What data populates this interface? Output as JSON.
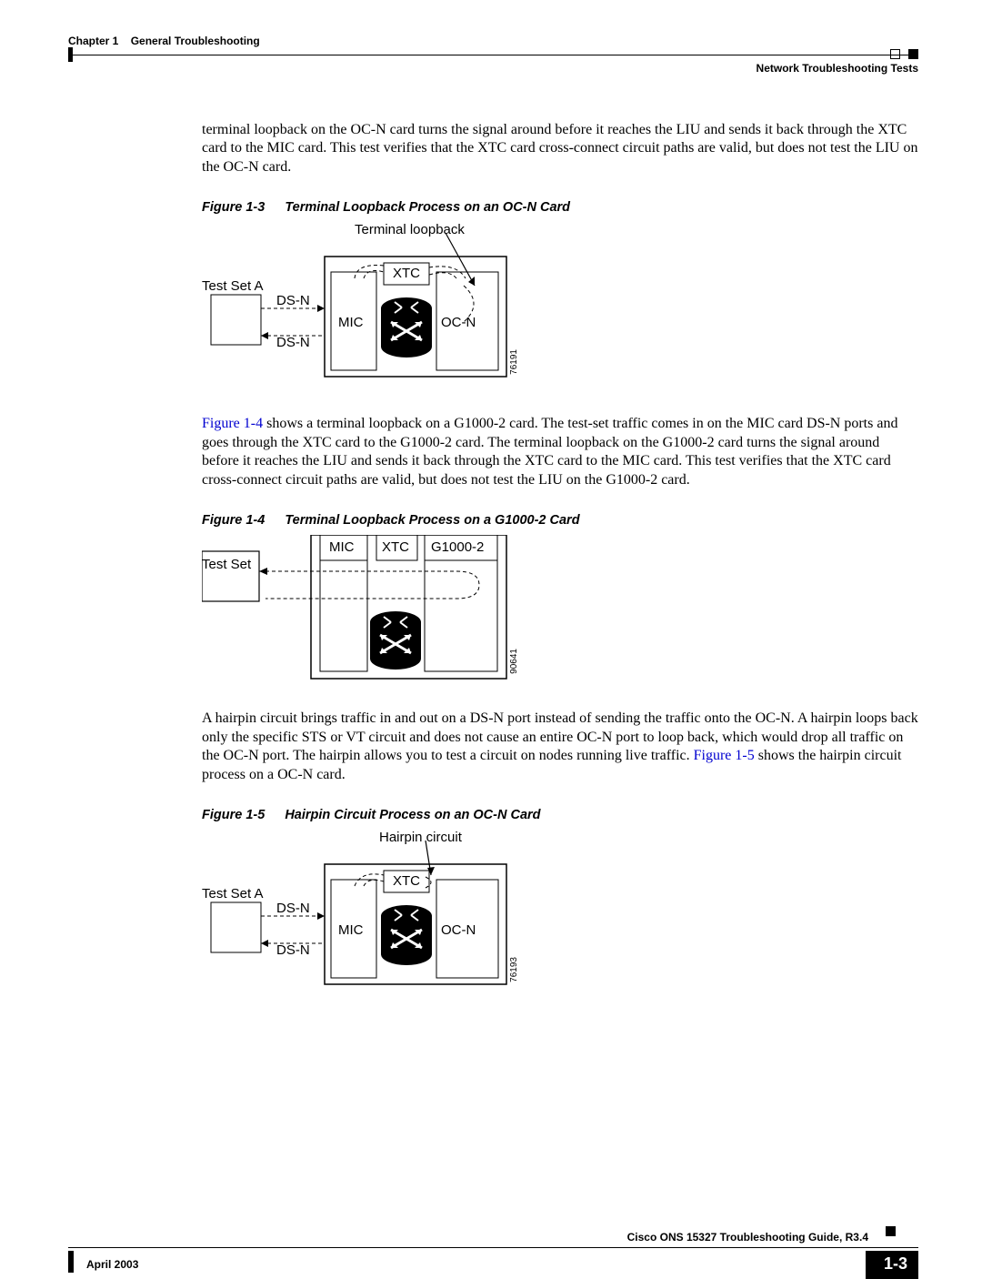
{
  "header": {
    "chapter_num": "Chapter 1",
    "chapter_name": "General Troubleshooting",
    "section": "Network Troubleshooting Tests"
  },
  "paragraphs": {
    "p1": "terminal loopback on the OC-N card turns the signal around before it reaches the LIU and sends it back through the XTC card to the MIC card. This test verifies that the XTC card cross-connect circuit paths are valid, but does not test the LIU on the OC-N card.",
    "p2_link": "Figure 1-4",
    "p2_rest": " shows a terminal loopback on a G1000-2 card. The test-set traffic comes in on the MIC card DS-N ports and goes through the XTC card to the G1000-2 card. The terminal loopback on the G1000-2 card turns the signal around before it reaches the LIU and sends it back through the XTC card to the MIC card. This test verifies that the XTC card cross-connect circuit paths are valid, but does not test the LIU on the G1000-2 card.",
    "p3_a": "A hairpin circuit brings traffic in and out on a DS-N port instead of sending the traffic onto the OC-N. A hairpin loops back only the specific STS or VT circuit and does not cause an entire OC-N port to loop back, which would drop all traffic on the OC-N port. The hairpin allows you to test a circuit on nodes running live traffic. ",
    "p3_link": "Figure 1-5",
    "p3_b": " shows the hairpin circuit process on a OC-N card."
  },
  "figures": {
    "f13": {
      "num": "Figure 1-3",
      "title": "Terminal Loopback Process on an OC-N Card"
    },
    "f14": {
      "num": "Figure 1-4",
      "title": "Terminal Loopback Process on a G1000-2 Card"
    },
    "f15": {
      "num": "Figure 1-5",
      "title": "Hairpin Circuit Process on an OC-N Card"
    }
  },
  "diagram1": {
    "top_label": "Terminal loopback",
    "test_set": "Test Set A",
    "dsn_top": "DS-N",
    "dsn_bot": "DS-N",
    "mic": "MIC",
    "xtc": "XTC",
    "ocn": "OC-N",
    "id": "76191"
  },
  "diagram2": {
    "test_set": "Test Set",
    "mic": "MIC",
    "xtc": "XTC",
    "g1000": "G1000-2",
    "id": "90641"
  },
  "diagram3": {
    "top_label": "Hairpin circuit",
    "test_set": "Test Set A",
    "dsn_top": "DS-N",
    "dsn_bot": "DS-N",
    "mic": "MIC",
    "xtc": "XTC",
    "ocn": "OC-N",
    "id": "76193"
  },
  "footer": {
    "doc_title": "Cisco ONS 15327 Troubleshooting Guide, R3.4",
    "date": "April 2003",
    "page": "1-3"
  }
}
